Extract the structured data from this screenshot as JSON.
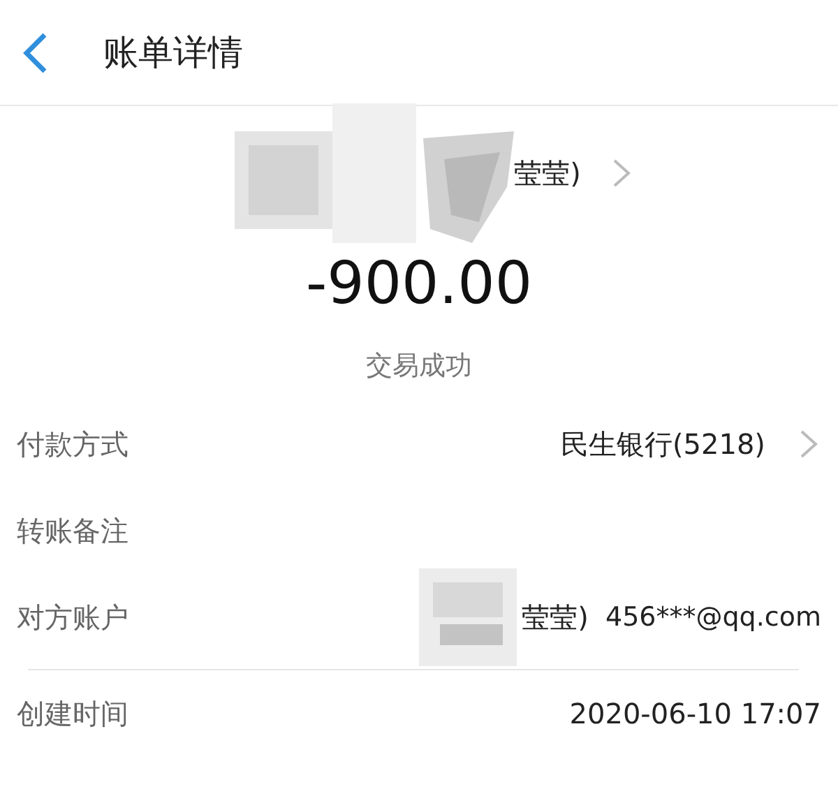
{
  "header": {
    "title": "账单详情"
  },
  "summary": {
    "name": "莹莹)",
    "amount": "-900.00",
    "status": "交易成功"
  },
  "details": [
    {
      "kind": "link",
      "label": "付款方式",
      "value": "民生银行(5218)"
    },
    {
      "kind": "empty",
      "label": "转账备注"
    },
    {
      "kind": "account",
      "label": "对方账户",
      "name": "莹莹)",
      "value": "456***@qq.com"
    },
    {
      "kind": "plain",
      "label": "创建时间",
      "value": "2020-06-10 17:07"
    }
  ]
}
